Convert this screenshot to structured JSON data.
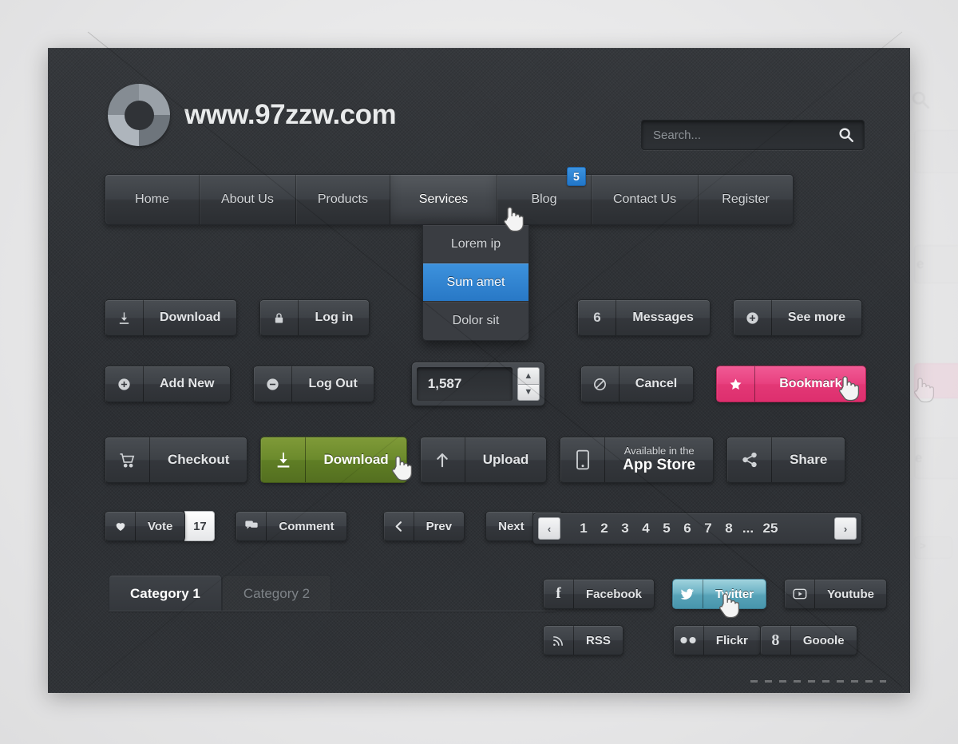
{
  "brand": {
    "site_title": "www.97zzw.com",
    "logo_icon": "donut-logo-icon"
  },
  "search": {
    "placeholder": "Search...",
    "value": "",
    "icon": "search-icon"
  },
  "nav": {
    "items": [
      {
        "label": "Home",
        "active": false,
        "badge": null
      },
      {
        "label": "About Us",
        "active": false,
        "badge": null
      },
      {
        "label": "Products",
        "active": false,
        "badge": null
      },
      {
        "label": "Services",
        "active": true,
        "badge": null
      },
      {
        "label": "Blog",
        "active": false,
        "badge": "5"
      },
      {
        "label": "Contact Us",
        "active": false,
        "badge": null
      },
      {
        "label": "Register",
        "active": false,
        "badge": null
      }
    ],
    "badge_color": "#2f83d2"
  },
  "dropdown": {
    "items": [
      {
        "label": "Lorem ip",
        "selected": false
      },
      {
        "label": "Sum amet",
        "selected": true
      },
      {
        "label": "Dolor sit",
        "selected": false
      }
    ],
    "highlight_color": "#3484d4"
  },
  "row1": [
    {
      "name": "download-button",
      "icon": "download-icon",
      "label": "Download"
    },
    {
      "name": "login-button",
      "icon": "lock-icon",
      "label": "Log in"
    },
    {
      "name": "messages-button",
      "icon": "count-6",
      "label": "Messages",
      "count": "6"
    },
    {
      "name": "see-more-button",
      "icon": "plus-circle-icon",
      "label": "See more"
    }
  ],
  "row2": {
    "add_new": {
      "label": "Add New",
      "icon": "plus-circle-icon"
    },
    "log_out": {
      "label": "Log Out",
      "icon": "minus-circle-icon"
    },
    "stepper": {
      "value": "1,587",
      "up_icon": "chevron-up-icon",
      "down_icon": "chevron-down-icon"
    },
    "cancel": {
      "label": "Cancel",
      "icon": "ban-icon"
    },
    "bookmark": {
      "label": "Bookmark",
      "icon": "star-icon",
      "color": "#e8407f"
    }
  },
  "row3": {
    "checkout": {
      "label": "Checkout",
      "icon": "cart-icon"
    },
    "download": {
      "label": "Download",
      "icon": "download-icon",
      "color": "#6b8a2c"
    },
    "upload": {
      "label": "Upload",
      "icon": "arrow-up-icon"
    },
    "appstore": {
      "line1": "Available in the",
      "line2": "App Store",
      "icon": "phone-icon"
    },
    "share": {
      "label": "Share",
      "icon": "share-nodes-icon"
    }
  },
  "row4": {
    "vote": {
      "label": "Vote",
      "icon": "heart-icon",
      "count": "17"
    },
    "comment": {
      "label": "Comment",
      "icon": "comment-icon"
    },
    "prev": {
      "label": "Prev",
      "icon": "chevron-left-icon"
    },
    "next": {
      "label": "Next",
      "icon": "chevron-right-icon"
    }
  },
  "pagination": {
    "prev_icon": "chevron-left-icon",
    "next_icon": "chevron-right-icon",
    "pages": [
      "1",
      "2",
      "3",
      "4",
      "5",
      "6",
      "7",
      "8",
      "...",
      "25"
    ]
  },
  "tabs": [
    {
      "label": "Category 1",
      "active": true
    },
    {
      "label": "Category 2",
      "active": false
    }
  ],
  "social": {
    "top": [
      {
        "name": "facebook-button",
        "label": "Facebook",
        "icon": "facebook-icon",
        "hovered": false
      },
      {
        "name": "twitter-button",
        "label": "Twitter",
        "icon": "twitter-icon",
        "hovered": true
      },
      {
        "name": "youtube-button",
        "label": "Youtube",
        "icon": "youtube-icon",
        "hovered": false
      }
    ],
    "bottom": [
      {
        "name": "rss-button",
        "label": "RSS",
        "icon": "rss-icon"
      },
      {
        "name": "flickr-button",
        "label": "Flickr",
        "icon": "flickr-icon"
      },
      {
        "name": "google-button",
        "label": "Gooole",
        "icon": "google-plus-icon"
      }
    ],
    "twitter_hover_color": "#58a3b8"
  },
  "theme": {
    "panel_background": "#303337",
    "page_background": "#ececed",
    "text_primary": "#e3e5e7",
    "accent_blue": "#3484d4"
  }
}
